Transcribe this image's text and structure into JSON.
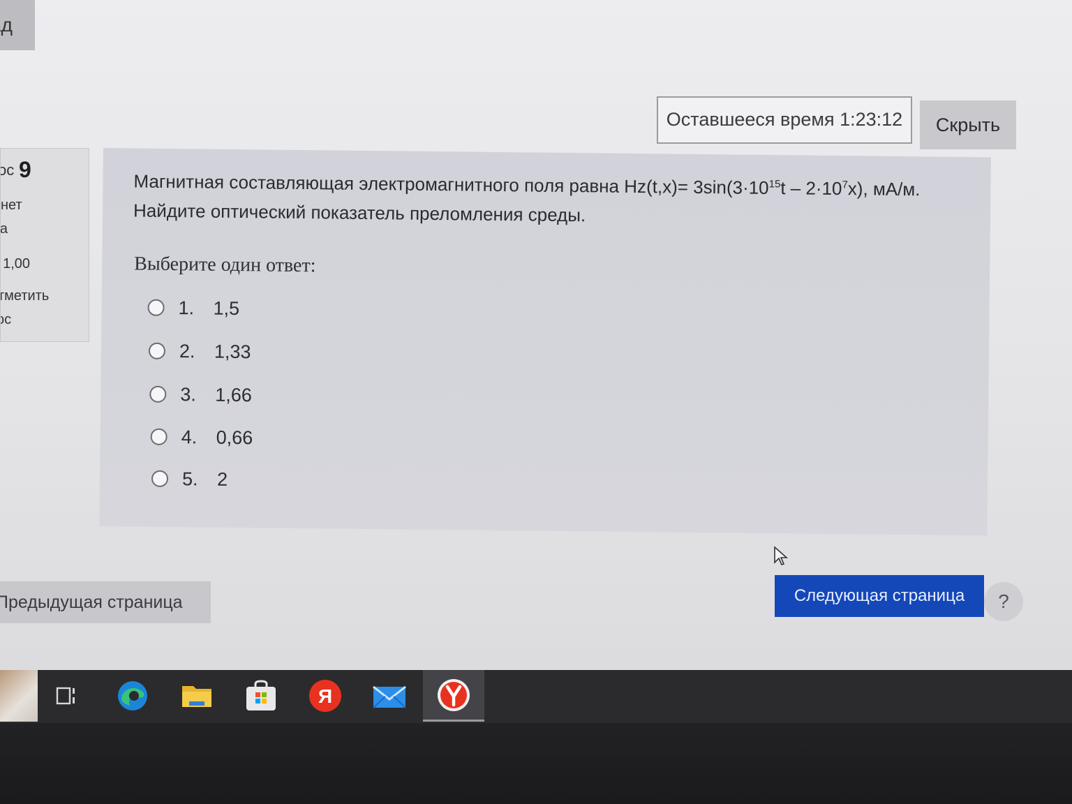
{
  "top_tab": {
    "label": "ад"
  },
  "timer": {
    "text": "Оставшееся время 1:23:12"
  },
  "hide_button": {
    "label": "Скрыть"
  },
  "question_info": {
    "prefix": "ос",
    "number": "9",
    "status_line1": "нет",
    "status_line2": "га",
    "grade": ": 1,00",
    "flag_line1": "тметить",
    "flag_line2": "ос"
  },
  "question": {
    "text_main": "Магнитная составляющая электромагнитного поля равна Hz(t,x)= 3sin(3·10",
    "exp1": "15",
    "text_mid": "t – 2·10",
    "exp2": "7",
    "text_end": "x), мА/м.",
    "line2": "Найдите оптический показатель преломления среды.",
    "prompt": "Выберите один ответ:",
    "answers": [
      {
        "number": "1.",
        "value": "1,5"
      },
      {
        "number": "2.",
        "value": "1,33"
      },
      {
        "number": "3.",
        "value": "1,66"
      },
      {
        "number": "4.",
        "value": "0,66"
      },
      {
        "number": "5.",
        "value": "2"
      }
    ]
  },
  "navigation": {
    "prev_label": "Предыдущая страница",
    "next_label": "Следующая страница",
    "help_label": "?"
  },
  "taskbar": {
    "items": [
      "app-thumbnail",
      "task-view-icon",
      "edge-icon",
      "file-explorer-icon",
      "store-icon",
      "yandex-icon",
      "mail-icon",
      "yandex-browser-icon"
    ]
  },
  "colors": {
    "accent_button": "#1448b8",
    "question_bg": "#d4d4da",
    "taskbar_bg": "#2b2b2e"
  }
}
